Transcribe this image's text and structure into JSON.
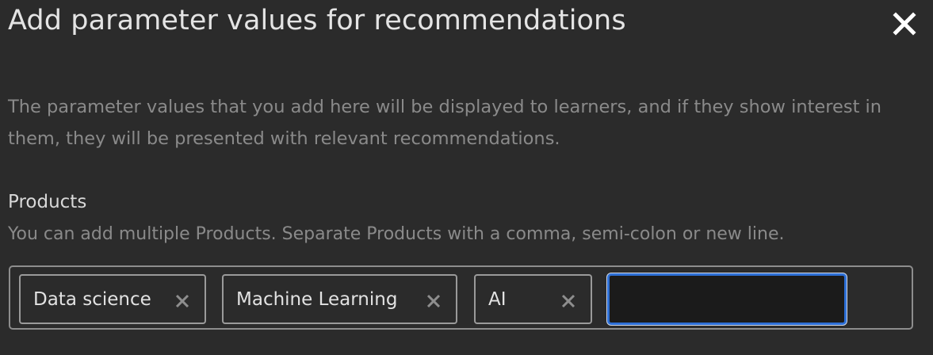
{
  "dialog": {
    "title": "Add parameter values for recommendations",
    "description": "The parameter values that you add here will be displayed to learners, and if they show interest in them, they will be presented with relevant recommendations.",
    "close_icon": "close-icon"
  },
  "field": {
    "label": "Products",
    "hint": "You can add multiple Products. Separate Products with a comma, semi-colon or new line.",
    "tags": [
      {
        "label": "Data science"
      },
      {
        "label": "Machine Learning"
      },
      {
        "label": "AI"
      }
    ],
    "input_value": "",
    "input_placeholder": ""
  },
  "colors": {
    "background": "#2b2b2b",
    "focus_border": "#2d6fd6",
    "muted_text": "#8a8a8a"
  }
}
